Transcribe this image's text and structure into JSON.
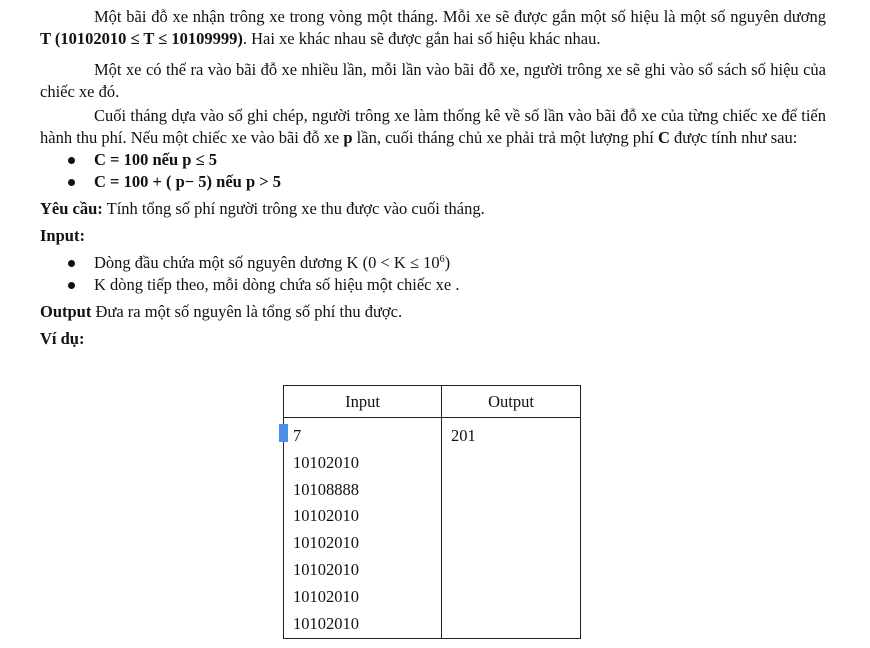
{
  "paragraphs": {
    "p1": {
      "text_a": "Một bãi đỗ xe nhận trông xe trong vòng một tháng. Mỗi xe sẽ được gắn một số hiệu là một số nguyên dương ",
      "bold": "T (10102010 ≤ T ≤ 10109999)",
      "text_b": ". Hai xe khác nhau sẽ được gắn hai số hiệu khác nhau."
    },
    "p2": {
      "text": "Một xe có thể ra vào bãi đỗ xe nhiều lần, mỗi lần vào bãi đỗ xe, người trông xe sẽ ghi vào sổ sách số hiệu của chiếc xe đó."
    },
    "p3": {
      "text_a": "Cuối tháng dựa vào sổ ghi chép, người trông xe làm thống kê về số lần vào bãi đỗ xe của từng chiếc xe để tiến hành thu phí. Nếu một chiếc xe vào bãi đỗ xe ",
      "bold_p": "p",
      "text_b": " lần, cuối tháng chủ xe phải trả một lượng phí ",
      "bold_c": "C",
      "text_c": " được tính như sau:"
    }
  },
  "fee_rules": [
    "C = 100 nếu p ≤ 5",
    "C = 100 + ( p− 5) nếu p > 5"
  ],
  "requirement": {
    "label": "Yêu cầu:",
    "text": " Tính tổng số phí người trông xe thu được vào cuối tháng."
  },
  "input_section": {
    "label": "Input:",
    "item1_a": "Dòng đầu chứa một số nguyên dương K (0 < K ≤ 10",
    "item1_sup": "6",
    "item1_b": ")",
    "item2": "K dòng tiếp theo, mỗi dòng chứa số hiệu một chiếc xe ."
  },
  "output_section": {
    "label": "Output",
    "text": " Đưa ra một số nguyên là tổng số phí thu được."
  },
  "example": {
    "label": "Ví dụ:",
    "header_input": "Input",
    "header_output": "Output",
    "input_lines": [
      "7",
      "10102010",
      "10108888",
      "10102010",
      "10102010",
      "10102010",
      "10102010",
      "10102010"
    ],
    "output_lines": [
      "201"
    ]
  }
}
